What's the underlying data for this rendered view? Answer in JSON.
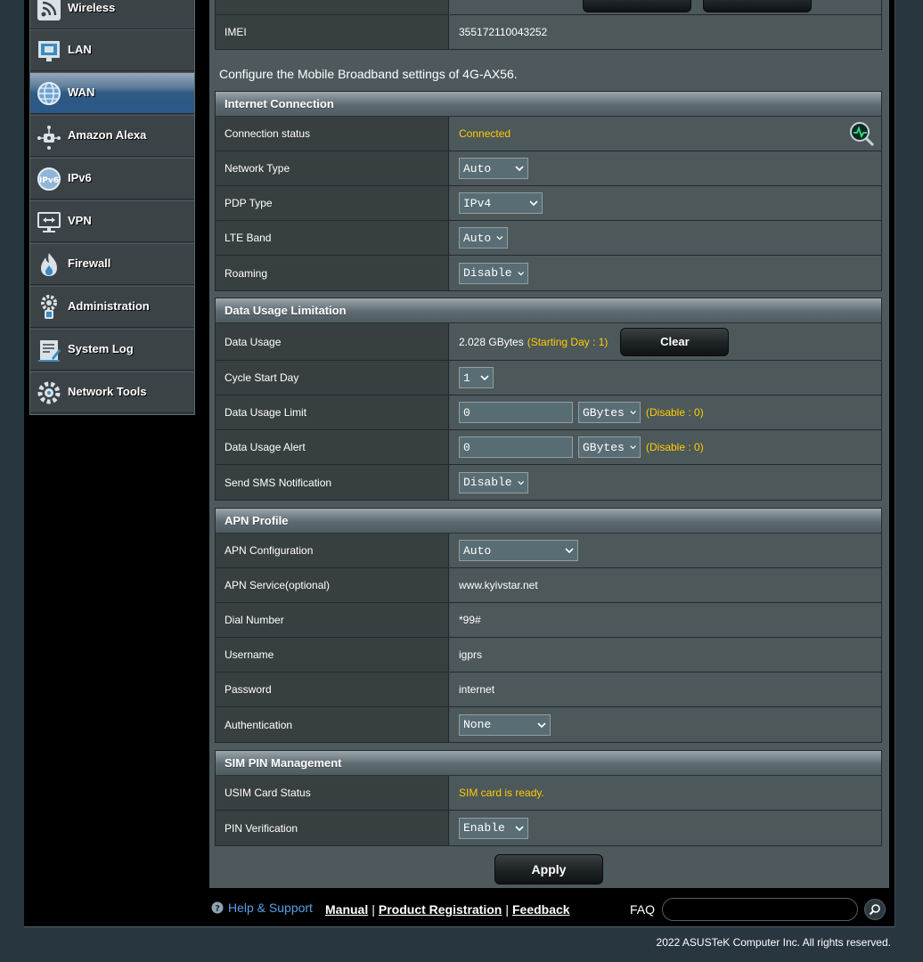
{
  "sidebar": {
    "items": [
      {
        "label": "Wireless",
        "icon": "wireless-icon"
      },
      {
        "label": "LAN",
        "icon": "lan-icon"
      },
      {
        "label": "WAN",
        "icon": "globe-icon",
        "active": true
      },
      {
        "label": "Amazon Alexa",
        "icon": "alexa-icon"
      },
      {
        "label": "IPv6",
        "icon": "ipv6-icon"
      },
      {
        "label": "VPN",
        "icon": "vpn-icon"
      },
      {
        "label": "Firewall",
        "icon": "firewall-icon"
      },
      {
        "label": "Administration",
        "icon": "administration-icon"
      },
      {
        "label": "System Log",
        "icon": "system-log-icon"
      },
      {
        "label": "Network Tools",
        "icon": "network-tools-icon"
      }
    ]
  },
  "top": {
    "imei_label": "IMEI",
    "imei_value": "355172110043252"
  },
  "intro": "Configure the Mobile Broadband settings of 4G-AX56.",
  "internet": {
    "header": "Internet Connection",
    "status_label": "Connection status",
    "status_value": "Connected",
    "network_type_label": "Network Type",
    "network_type_value": "Auto",
    "pdp_label": "PDP Type",
    "pdp_value": "IPv4",
    "lte_label": "LTE Band",
    "lte_value": "Auto",
    "roaming_label": "Roaming",
    "roaming_value": "Disable"
  },
  "data_usage": {
    "header": "Data Usage Limitation",
    "usage_label": "Data Usage",
    "usage_value": "2.028 GBytes",
    "starting_day": "(Starting Day : 1)",
    "clear_label": "Clear",
    "cycle_label": "Cycle Start Day",
    "cycle_value": "1",
    "limit_label": "Data Usage Limit",
    "limit_value": "0",
    "limit_unit": "GBytes",
    "limit_hint": "(Disable : 0)",
    "alert_label": "Data Usage Alert",
    "alert_value": "0",
    "alert_unit": "GBytes",
    "alert_hint": "(Disable : 0)",
    "sms_label": "Send SMS Notification",
    "sms_value": "Disable"
  },
  "apn": {
    "header": "APN Profile",
    "config_label": "APN Configuration",
    "config_value": "Auto",
    "service_label": "APN Service(optional)",
    "service_value": "www.kyivstar.net",
    "dial_label": "Dial Number",
    "dial_value": "*99#",
    "username_label": "Username",
    "username_value": "igprs",
    "password_label": "Password",
    "password_value": "internet",
    "auth_label": "Authentication",
    "auth_value": "None"
  },
  "sim": {
    "header": "SIM PIN Management",
    "status_label": "USIM Card Status",
    "status_value": "SIM card is ready.",
    "pin_label": "PIN Verification",
    "pin_value": "Enable"
  },
  "apply_label": "Apply",
  "footer": {
    "help": "Help & Support",
    "manual": "Manual",
    "registration": "Product Registration",
    "feedback": "Feedback",
    "faq": "FAQ",
    "copyright": "2022 ASUSTeK Computer Inc. All rights reserved."
  },
  "colors": {
    "accent_yellow": "#ffcc00",
    "active_blue": "#2b5786",
    "help_blue": "#5aa0e6"
  }
}
